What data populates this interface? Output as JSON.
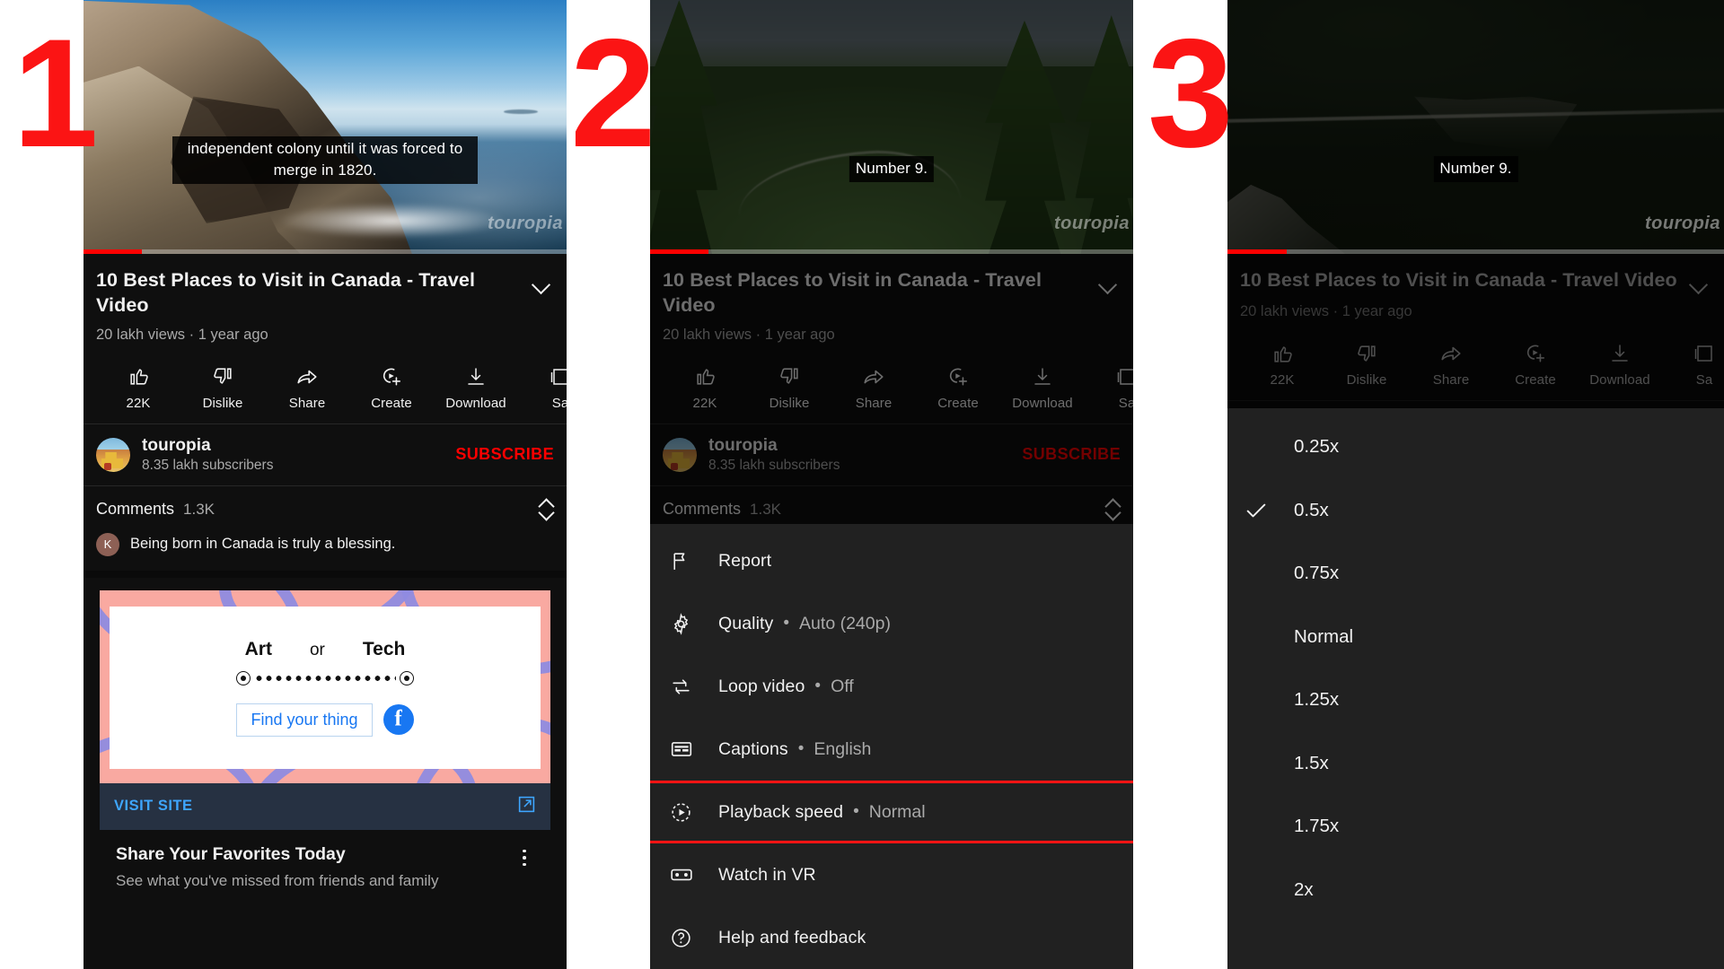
{
  "steps": {
    "one": "1",
    "two": "2",
    "three": "3"
  },
  "accent": {
    "red": "#fb1414",
    "youtube_red": "#ff0000",
    "link_blue": "#3ea6ff"
  },
  "video": {
    "title": "10 Best Places to Visit in Canada - Travel Video",
    "stats": "20 lakh views · 1 year ago",
    "watermark": "touropia",
    "caption_panel1": "independent colony until it was forced to\nmerge in 1820.",
    "caption_panel2": "Number 9.",
    "caption_panel3": "Number 9."
  },
  "actions": [
    {
      "name": "like",
      "label": "22K"
    },
    {
      "name": "dislike",
      "label": "Dislike"
    },
    {
      "name": "share",
      "label": "Share"
    },
    {
      "name": "create",
      "label": "Create"
    },
    {
      "name": "download",
      "label": "Download"
    },
    {
      "name": "save",
      "label": "Sa"
    }
  ],
  "channel": {
    "name": "touropia",
    "subscribers": "8.35 lakh subscribers",
    "subscribe_label": "SUBSCRIBE"
  },
  "comments": {
    "heading": "Comments",
    "count": "1.3K",
    "first": {
      "avatar_letter": "K",
      "text": "Being born in Canada is truly a blessing."
    }
  },
  "ad": {
    "word_left": "Art",
    "word_mid": "or",
    "word_right": "Tech",
    "button": "Find your thing",
    "visit_label": "VISIT SITE",
    "title": "Share Your Favorites Today",
    "subtitle": "See what you've missed from friends and family"
  },
  "menu": {
    "items": [
      {
        "icon": "flag-icon",
        "label": "Report",
        "dot": "",
        "value": ""
      },
      {
        "icon": "gear-icon",
        "label": "Quality",
        "dot": "•",
        "value": "Auto (240p)"
      },
      {
        "icon": "loop-icon",
        "label": "Loop video",
        "dot": "•",
        "value": "Off"
      },
      {
        "icon": "captions-icon",
        "label": "Captions",
        "dot": "•",
        "value": "English"
      },
      {
        "icon": "playback-speed-icon",
        "label": "Playback speed",
        "dot": "•",
        "value": "Normal"
      },
      {
        "icon": "vr-icon",
        "label": "Watch in VR",
        "dot": "",
        "value": ""
      },
      {
        "icon": "help-icon",
        "label": "Help and feedback",
        "dot": "",
        "value": ""
      }
    ]
  },
  "speeds": {
    "options": [
      {
        "label": "0.25x",
        "selected": false
      },
      {
        "label": "0.5x",
        "selected": true
      },
      {
        "label": "0.75x",
        "selected": false
      },
      {
        "label": "Normal",
        "selected": false
      },
      {
        "label": "1.25x",
        "selected": false
      },
      {
        "label": "1.5x",
        "selected": false
      },
      {
        "label": "1.75x",
        "selected": false
      },
      {
        "label": "2x",
        "selected": false
      }
    ]
  }
}
